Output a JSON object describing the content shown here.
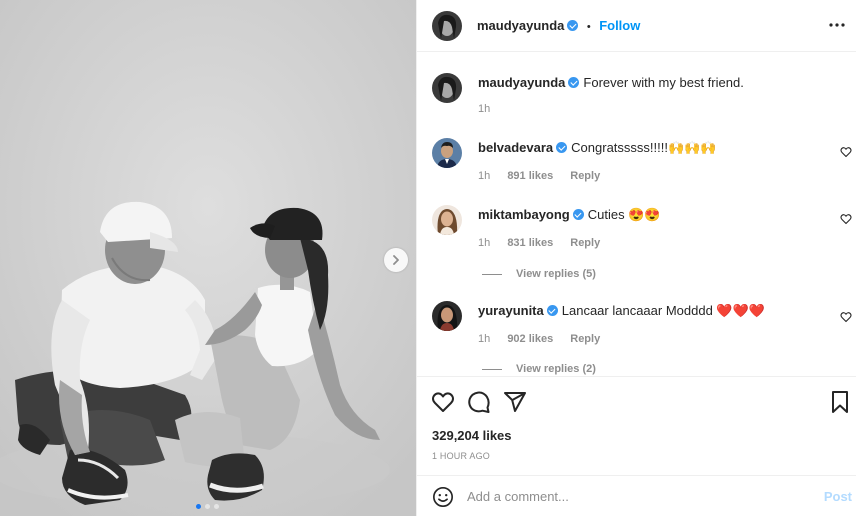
{
  "post": {
    "author": "maudyayunda",
    "follow_label": "Follow",
    "header_separator": "•",
    "caption": {
      "username": "maudyayunda",
      "text": "Forever with my best friend.",
      "time": "1h"
    },
    "carousel": {
      "current_index": 1,
      "total": 3
    },
    "likes": "329,204 likes",
    "time_ago": "1 HOUR AGO"
  },
  "comments": [
    {
      "username": "belvadevara",
      "verified": true,
      "text": "Congratsssss!!!!!🙌🙌🙌",
      "time": "1h",
      "likes": "891 likes",
      "reply_label": "Reply",
      "view_replies": ""
    },
    {
      "username": "miktambayong",
      "verified": true,
      "text": "Cuties 😍😍",
      "time": "1h",
      "likes": "831 likes",
      "reply_label": "Reply",
      "view_replies": "View replies (5)"
    },
    {
      "username": "yurayunita",
      "verified": true,
      "text": "Lancaar lancaaar Modddd ❤️❤️❤️",
      "time": "1h",
      "likes": "902 likes",
      "reply_label": "Reply",
      "view_replies": "View replies (2)"
    }
  ],
  "add_comment": {
    "placeholder": "Add a comment...",
    "post_label": "Post"
  },
  "colors": {
    "accent": "#0095f6",
    "verified": "#3897f0",
    "muted": "#8e8e8e",
    "post_disabled": "#b3dbff",
    "heart_red": "#ed4956"
  },
  "icons": {
    "like": "heart-icon",
    "comment": "comment-bubble-icon",
    "share": "paper-plane-icon",
    "save": "bookmark-icon",
    "emoji": "smiley-icon",
    "more": "more-dots-icon",
    "next": "chevron-right-icon"
  }
}
